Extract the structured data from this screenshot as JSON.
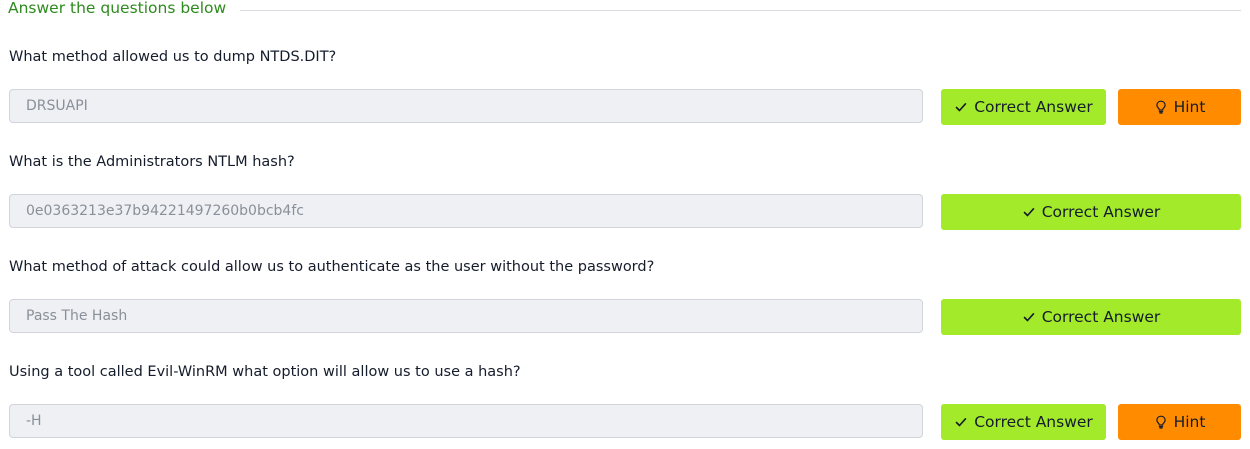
{
  "section": {
    "title": "Answer the questions below"
  },
  "questions": [
    {
      "text": "What method allowed us to dump NTDS.DIT?",
      "answer": "DRSUAPI",
      "correct_label": "Correct Answer",
      "hint_label": "Hint",
      "has_hint": true
    },
    {
      "text": "What is the Administrators NTLM hash?",
      "answer": "0e0363213e37b94221497260b0bcb4fc",
      "correct_label": "Correct Answer",
      "has_hint": false
    },
    {
      "text": "What method of attack could allow us to authenticate as the user without the password?",
      "answer": "Pass The Hash",
      "correct_label": "Correct Answer",
      "has_hint": false
    },
    {
      "text": "Using a tool called Evil-WinRM what option will allow us to use a hash?",
      "answer": "-H",
      "correct_label": "Correct Answer",
      "hint_label": "Hint",
      "has_hint": true
    }
  ],
  "colors": {
    "title_green": "#2e8b1e",
    "correct_button": "#a3ea2a",
    "hint_button": "#ff8c00",
    "field_background": "#eef0f3"
  },
  "icons": {
    "correct": "check-icon",
    "hint": "lightbulb-icon"
  }
}
